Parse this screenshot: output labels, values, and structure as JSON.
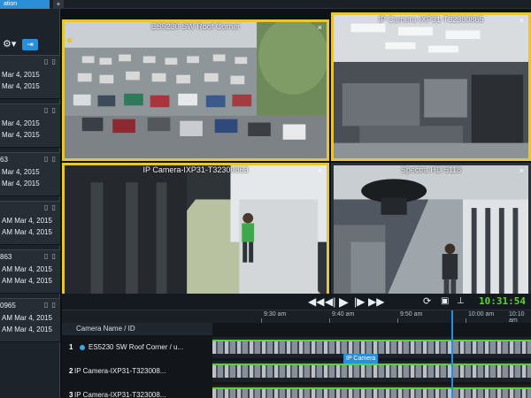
{
  "app_tab": "ation",
  "left_panel": {
    "clips": [
      {
        "id": "",
        "date1": "Mar 4, 2015",
        "date2": "Mar 4, 2015"
      },
      {
        "id": "",
        "date1": "Mar 4, 2015",
        "date2": "Mar 4, 2015"
      },
      {
        "id": "63",
        "date1": "Mar 4, 2015",
        "date2": "Mar 4, 2015"
      },
      {
        "id": "",
        "date1": "AM  Mar 4, 2015",
        "date2": "AM  Mar 4, 2015"
      },
      {
        "id": "863",
        "date1": "AM  Mar 4, 2015",
        "date2": "AM  Mar 4, 2015"
      },
      {
        "id": "0965",
        "date1": "AM  Mar 4, 2015",
        "date2": "AM  Mar 4, 2015"
      }
    ]
  },
  "cameras": [
    {
      "title": "ES5230 SW Roof Corner"
    },
    {
      "title": "IP Camera-IXP31-T32300865"
    },
    {
      "title": "IP Camera-IXP31-T32300863"
    },
    {
      "title": "Spectra HD 5118"
    }
  ],
  "controls": {
    "prev": "◀◀",
    "step_back": "◀|",
    "play": "▶",
    "step_fwd": "|▶",
    "next": "▶▶",
    "time": "10:31:54"
  },
  "timeline": {
    "column_header": "Camera Name / ID",
    "ticks": [
      "9:30 am",
      "9:40 am",
      "9:50 am",
      "10:00 am",
      "10:10 am"
    ],
    "tracks": [
      {
        "num": "1",
        "name": "ES5230 SW Roof Corner / u..."
      },
      {
        "num": "2",
        "name": "IP Camera-IXP31-T323008..."
      },
      {
        "num": "3",
        "name": "IP Camera-IXP31-T323008..."
      }
    ],
    "marker": "IP Camera"
  },
  "colors": {
    "accent_yellow": "#e9c630",
    "accent_blue": "#2a8fd6",
    "accent_green": "#57d234"
  }
}
